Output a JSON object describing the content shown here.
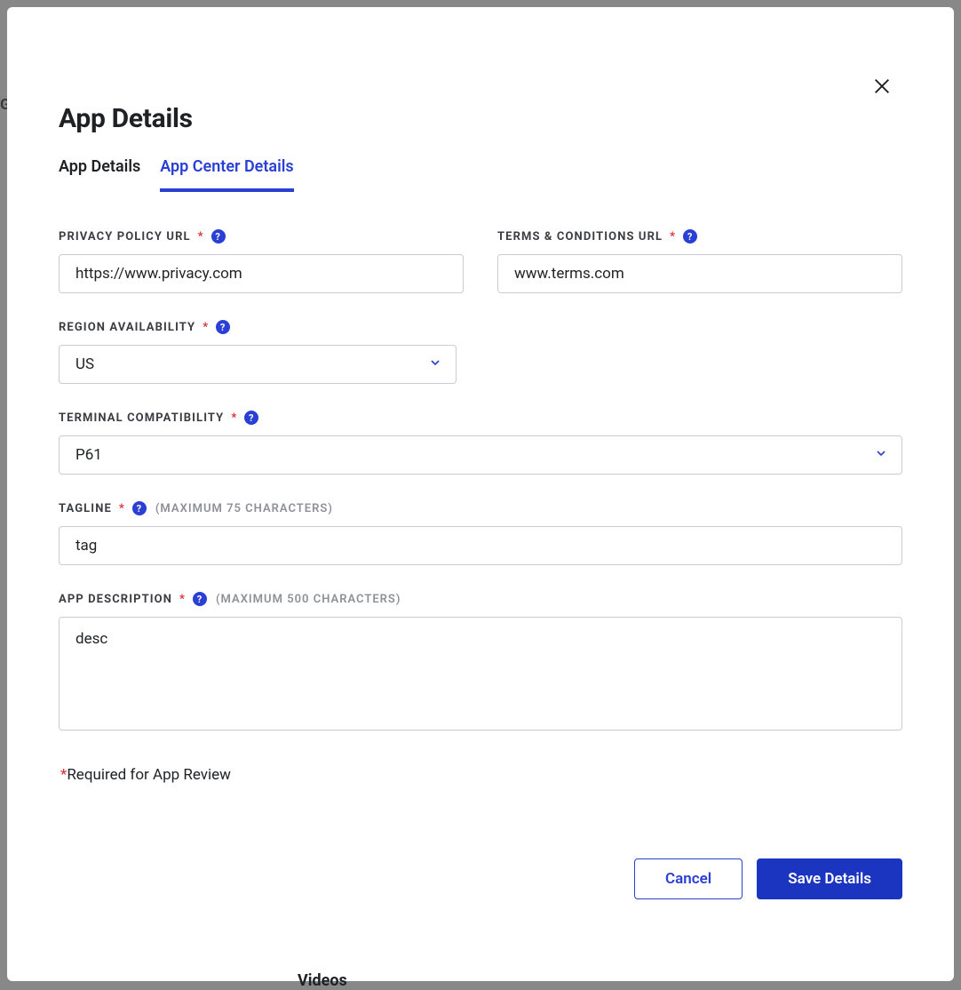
{
  "modal": {
    "title": "App Details",
    "close_aria": "Close"
  },
  "tabs": [
    {
      "label": "App Details",
      "active": false
    },
    {
      "label": "App Center Details",
      "active": true
    }
  ],
  "fields": {
    "privacy": {
      "label": "Privacy Policy URL",
      "value": "https://www.privacy.com"
    },
    "terms": {
      "label": "Terms & Conditions URL",
      "value": "www.terms.com"
    },
    "region": {
      "label": "Region Availability",
      "value": "US"
    },
    "terminal": {
      "label": "Terminal Compatibility",
      "value": "P61"
    },
    "tagline": {
      "label": "Tagline",
      "hint": "(Maximum 75 characters)",
      "value": "tag"
    },
    "description": {
      "label": "App Description",
      "hint": "(Maximum 500 characters)",
      "value": "desc"
    }
  },
  "footnote": {
    "asterisk": "*",
    "text": "Required for App Review"
  },
  "actions": {
    "cancel": "Cancel",
    "save": "Save Details"
  },
  "background": {
    "videos_heading": "Videos",
    "left_char": "G"
  },
  "icons": {
    "help": "?"
  }
}
